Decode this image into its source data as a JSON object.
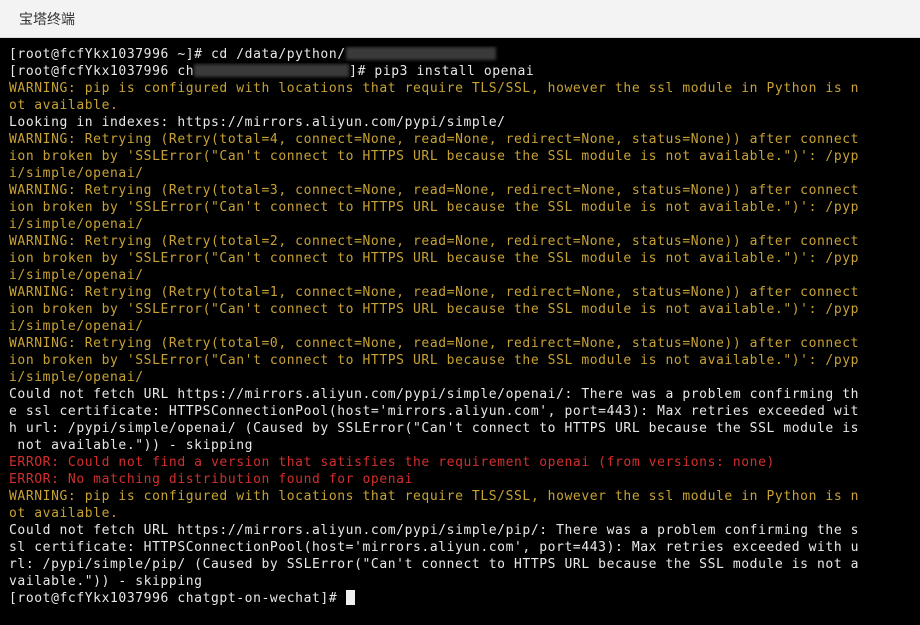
{
  "window": {
    "title": "宝塔终端"
  },
  "terminal": {
    "colors": {
      "background": "#000000",
      "text": "#e8e8e8",
      "warning": "#c7a234",
      "error": "#d22e2e"
    },
    "lines": [
      {
        "type": "prompt-redacted-end",
        "text": "[root@fcfYkx1037996 ~]# cd /data/python/"
      },
      {
        "type": "prompt-redacted-mid",
        "before": "[root@fcfYkx1037996 ch",
        "after": "]# pip3 install openai"
      },
      {
        "type": "warn",
        "text": "WARNING: pip is configured with locations that require TLS/SSL, however the ssl module in Python is n"
      },
      {
        "type": "warn",
        "text": "ot available."
      },
      {
        "type": "white",
        "text": "Looking in indexes: https://mirrors.aliyun.com/pypi/simple/"
      },
      {
        "type": "warn",
        "text": "WARNING: Retrying (Retry(total=4, connect=None, read=None, redirect=None, status=None)) after connect"
      },
      {
        "type": "warn",
        "text": "ion broken by 'SSLError(\"Can't connect to HTTPS URL because the SSL module is not available.\")': /pyp"
      },
      {
        "type": "warn",
        "text": "i/simple/openai/"
      },
      {
        "type": "warn",
        "text": "WARNING: Retrying (Retry(total=3, connect=None, read=None, redirect=None, status=None)) after connect"
      },
      {
        "type": "warn",
        "text": "ion broken by 'SSLError(\"Can't connect to HTTPS URL because the SSL module is not available.\")': /pyp"
      },
      {
        "type": "warn",
        "text": "i/simple/openai/"
      },
      {
        "type": "warn",
        "text": "WARNING: Retrying (Retry(total=2, connect=None, read=None, redirect=None, status=None)) after connect"
      },
      {
        "type": "warn",
        "text": "ion broken by 'SSLError(\"Can't connect to HTTPS URL because the SSL module is not available.\")': /pyp"
      },
      {
        "type": "warn",
        "text": "i/simple/openai/"
      },
      {
        "type": "warn",
        "text": "WARNING: Retrying (Retry(total=1, connect=None, read=None, redirect=None, status=None)) after connect"
      },
      {
        "type": "warn",
        "text": "ion broken by 'SSLError(\"Can't connect to HTTPS URL because the SSL module is not available.\")': /pyp"
      },
      {
        "type": "warn",
        "text": "i/simple/openai/"
      },
      {
        "type": "warn",
        "text": "WARNING: Retrying (Retry(total=0, connect=None, read=None, redirect=None, status=None)) after connect"
      },
      {
        "type": "warn",
        "text": "ion broken by 'SSLError(\"Can't connect to HTTPS URL because the SSL module is not available.\")': /pyp"
      },
      {
        "type": "warn",
        "text": "i/simple/openai/"
      },
      {
        "type": "white",
        "text": "Could not fetch URL https://mirrors.aliyun.com/pypi/simple/openai/: There was a problem confirming th"
      },
      {
        "type": "white",
        "text": "e ssl certificate: HTTPSConnectionPool(host='mirrors.aliyun.com', port=443): Max retries exceeded wit"
      },
      {
        "type": "white",
        "text": "h url: /pypi/simple/openai/ (Caused by SSLError(\"Can't connect to HTTPS URL because the SSL module is"
      },
      {
        "type": "white",
        "text": " not available.\")) - skipping"
      },
      {
        "type": "err",
        "text": "ERROR: Could not find a version that satisfies the requirement openai (from versions: none)"
      },
      {
        "type": "err",
        "text": "ERROR: No matching distribution found for openai"
      },
      {
        "type": "warn",
        "text": "WARNING: pip is configured with locations that require TLS/SSL, however the ssl module in Python is n"
      },
      {
        "type": "warn",
        "text": "ot available."
      },
      {
        "type": "white",
        "text": "Could not fetch URL https://mirrors.aliyun.com/pypi/simple/pip/: There was a problem confirming the s"
      },
      {
        "type": "white",
        "text": "sl certificate: HTTPSConnectionPool(host='mirrors.aliyun.com', port=443): Max retries exceeded with u"
      },
      {
        "type": "white",
        "text": "rl: /pypi/simple/pip/ (Caused by SSLError(\"Can't connect to HTTPS URL because the SSL module is not a"
      },
      {
        "type": "white",
        "text": "vailable.\")) - skipping"
      },
      {
        "type": "prompt-cursor",
        "text": "[root@fcfYkx1037996 chatgpt-on-wechat]# "
      }
    ]
  }
}
